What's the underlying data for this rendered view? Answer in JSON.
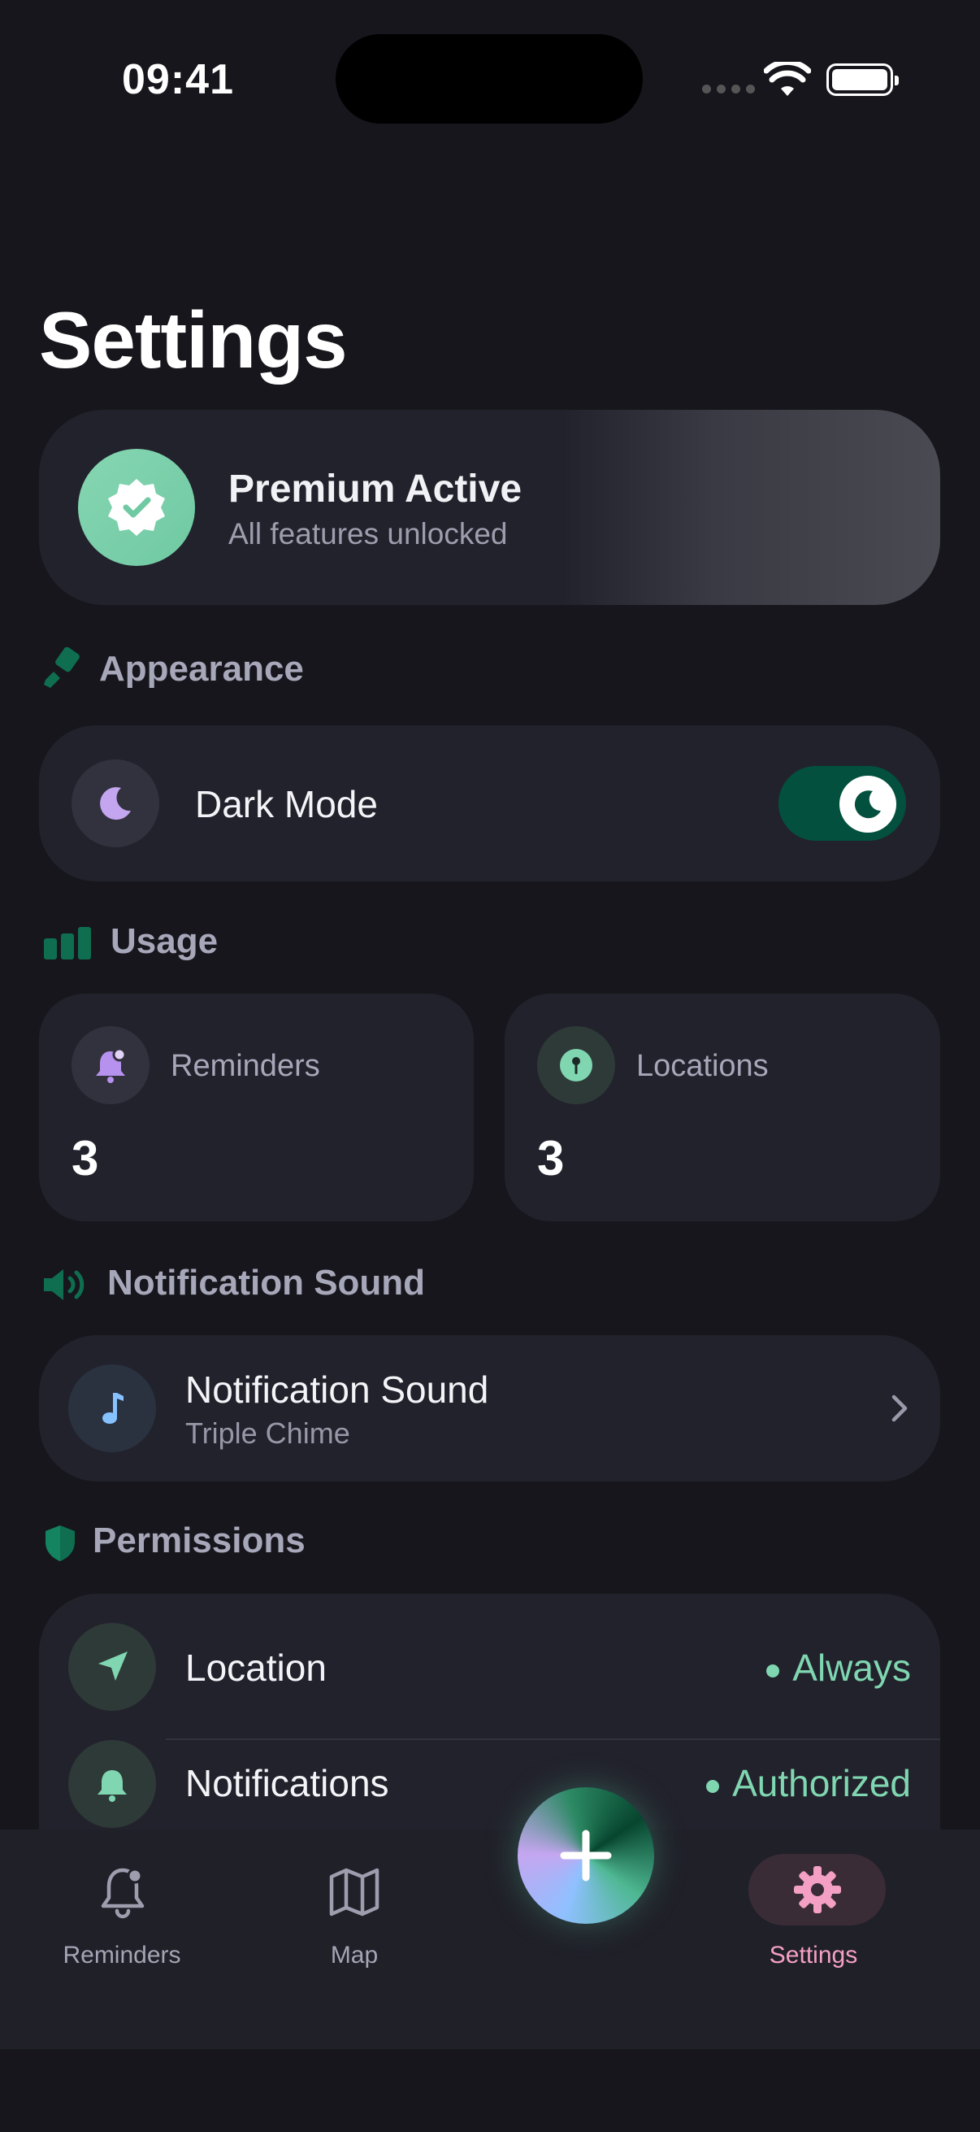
{
  "status_bar": {
    "time": "09:41"
  },
  "page": {
    "title": "Settings"
  },
  "premium": {
    "title": "Premium Active",
    "subtitle": "All features unlocked",
    "icon": "verified-badge-icon"
  },
  "appearance": {
    "section_title": "Appearance",
    "dark_mode": {
      "label": "Dark Mode",
      "enabled": true,
      "icon": "moon-icon"
    }
  },
  "usage": {
    "section_title": "Usage",
    "stats": [
      {
        "label": "Reminders",
        "value": "3",
        "icon": "bell-icon"
      },
      {
        "label": "Locations",
        "value": "3",
        "icon": "pin-icon"
      }
    ]
  },
  "sound": {
    "section_title": "Notification Sound",
    "row": {
      "label": "Notification Sound",
      "value": "Triple Chime",
      "icon": "music-note-icon"
    }
  },
  "permissions": {
    "section_title": "Permissions",
    "items": [
      {
        "label": "Location",
        "status": "Always",
        "icon": "location-arrow-icon"
      },
      {
        "label": "Notifications",
        "status": "Authorized",
        "icon": "bell-icon"
      }
    ]
  },
  "tabbar": {
    "tabs": [
      {
        "label": "Reminders",
        "icon": "bell-icon",
        "active": false
      },
      {
        "label": "Map",
        "icon": "map-icon",
        "active": false
      },
      {
        "label": "Settings",
        "icon": "gear-icon",
        "active": true
      }
    ],
    "add_button_icon": "plus-icon"
  },
  "colors": {
    "background": "#16161c",
    "card": "#22222c",
    "accent_green": "#7fd6b0",
    "toggle_on": "#03503e",
    "active_tab": "#f4a0c4",
    "section_title": "#a7a7ba"
  }
}
